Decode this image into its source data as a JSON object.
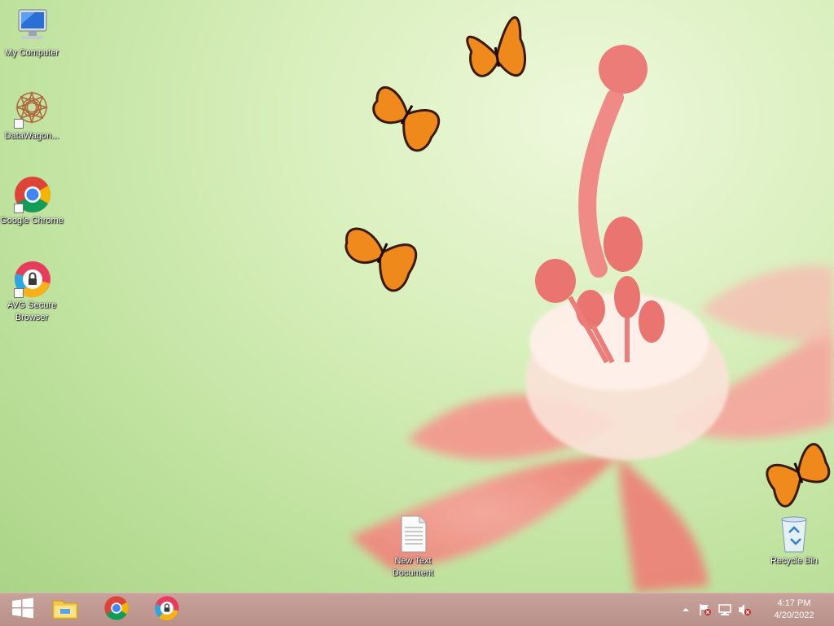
{
  "desktop": {
    "icons": [
      {
        "label": "My Computer"
      },
      {
        "label": "DataWagon..."
      },
      {
        "label": "Google Chrome"
      },
      {
        "label": "AVG Secure Browser"
      },
      {
        "label": "New Text Document"
      },
      {
        "label": "Recycle Bin"
      }
    ]
  },
  "taskbar": {
    "start_icon": "windows-logo-icon",
    "pinned": [
      {
        "icon": "file-explorer-icon"
      },
      {
        "icon": "chrome-icon"
      },
      {
        "icon": "avg-secure-browser-icon"
      }
    ],
    "tray": {
      "time": "4:17 PM",
      "date": "4/20/2022",
      "icons": [
        "show-hidden-icons-arrow",
        "action-center-flag-icon",
        "network-icon",
        "volume-muted-icon"
      ]
    }
  },
  "colors": {
    "taskbar": "#bf968f",
    "wallpaper_green": "#c4e5a3",
    "flower_pink": "#f28a82"
  }
}
